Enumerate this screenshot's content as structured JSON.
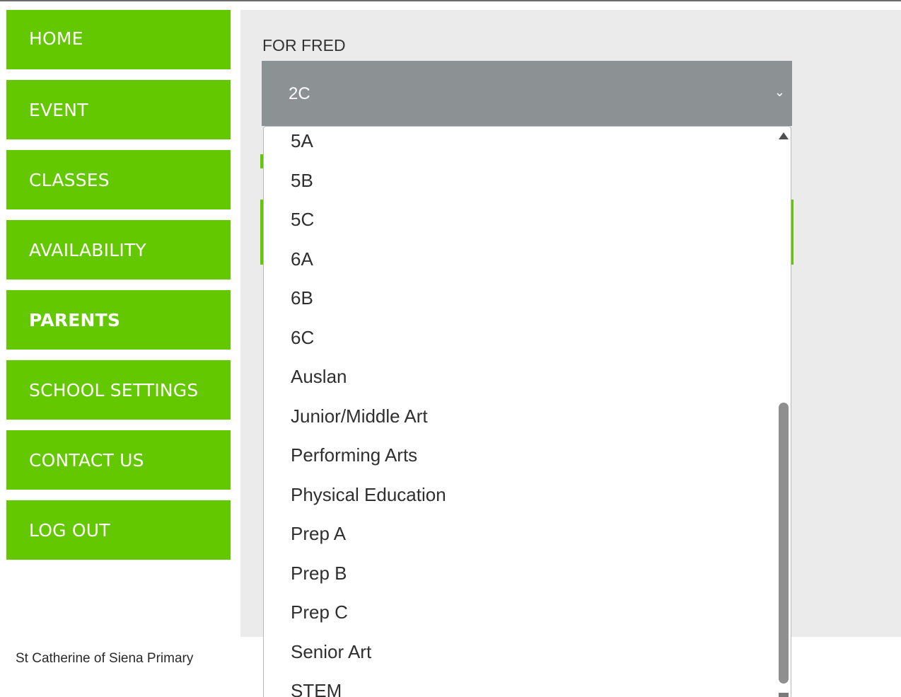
{
  "nav": {
    "items": [
      {
        "label": "HOME"
      },
      {
        "label": "EVENT"
      },
      {
        "label": "CLASSES"
      },
      {
        "label": "AVAILABILITY"
      },
      {
        "label": "PARENTS"
      },
      {
        "label": "SCHOOL SETTINGS"
      },
      {
        "label": "CONTACT US"
      },
      {
        "label": "LOG OUT"
      }
    ],
    "active": "PARENTS"
  },
  "footer": {
    "school_name": "St Catherine of Siena Primary"
  },
  "form": {
    "label": "FOR FRED",
    "selected": "2C",
    "options": [
      "5A",
      "5B",
      "5C",
      "6A",
      "6B",
      "6C",
      "Auslan",
      "Junior/Middle Art",
      "Performing Arts",
      "Physical Education",
      "Prep A",
      "Prep B",
      "Prep C",
      "Senior Art",
      "STEM"
    ]
  },
  "colors": {
    "accent": "#64c800",
    "select_bg": "#8c9194",
    "panel_bg": "#ebebeb"
  },
  "icons": {
    "select": "chevron-down-icon",
    "scroll_up": "scroll-up-arrow-icon",
    "scroll_down": "scroll-down-arrow-icon"
  }
}
